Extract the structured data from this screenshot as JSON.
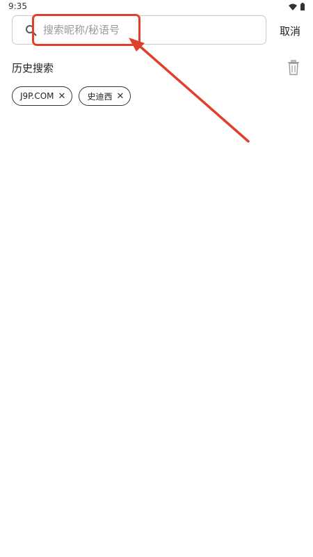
{
  "status_bar": {
    "time": "9:35"
  },
  "search": {
    "placeholder": "搜索昵称/秘语号",
    "value": "",
    "cancel_label": "取消"
  },
  "history": {
    "title": "历史搜索",
    "tags": [
      {
        "label": "J9P.COM",
        "close": "✕"
      },
      {
        "label": "史迪西",
        "close": "✕"
      }
    ]
  },
  "icons": {
    "search": "search-icon",
    "trash": "trash-icon",
    "wifi": "wifi-icon",
    "battery": "battery-icon"
  },
  "colors": {
    "annotation": "#e0402b",
    "border": "#c9c9c9",
    "placeholder": "#9a9a9a"
  }
}
